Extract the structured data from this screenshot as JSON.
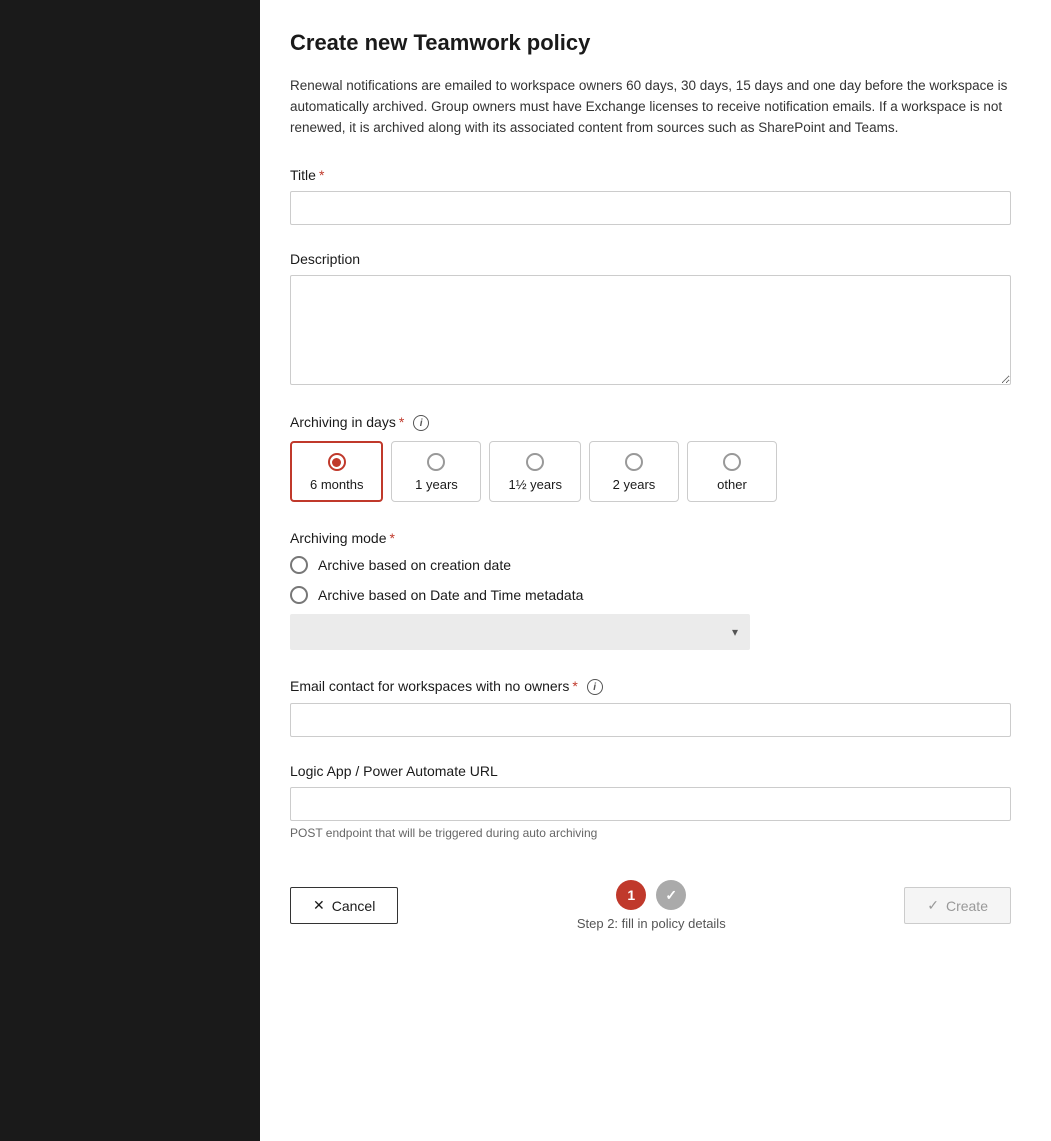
{
  "page": {
    "title": "Create new Teamwork policy",
    "description": "Renewal notifications are emailed to workspace owners 60 days, 30 days, 15 days and one day before the workspace is automatically archived. Group owners must have Exchange licenses to receive notification emails. If a workspace is not renewed, it is archived along with its associated content from sources such as SharePoint and Teams."
  },
  "form": {
    "title_label": "Title",
    "title_placeholder": "",
    "description_label": "Description",
    "description_placeholder": "",
    "archiving_days_label": "Archiving in days",
    "archiving_days_options": [
      {
        "value": "6months",
        "label": "6 months",
        "selected": true
      },
      {
        "value": "1years",
        "label": "1 years",
        "selected": false
      },
      {
        "value": "1.5years",
        "label": "1½ years",
        "selected": false
      },
      {
        "value": "2years",
        "label": "2 years",
        "selected": false
      },
      {
        "value": "other",
        "label": "other",
        "selected": false
      }
    ],
    "archiving_mode_label": "Archiving mode",
    "archiving_mode_options": [
      {
        "value": "creation_date",
        "label": "Archive based on creation date"
      },
      {
        "value": "date_time_metadata",
        "label": "Archive based on Date and Time metadata"
      }
    ],
    "archiving_mode_dropdown_placeholder": "",
    "email_contact_label": "Email contact for workspaces with no owners",
    "email_contact_placeholder": "",
    "logic_app_label": "Logic App / Power Automate URL",
    "logic_app_placeholder": "",
    "logic_app_hint": "POST endpoint that will be triggered during auto archiving"
  },
  "bottom_bar": {
    "cancel_label": "Cancel",
    "create_label": "Create",
    "step_label": "Step 2: fill in policy details",
    "step1_number": "1",
    "step2_icon": "✓"
  }
}
